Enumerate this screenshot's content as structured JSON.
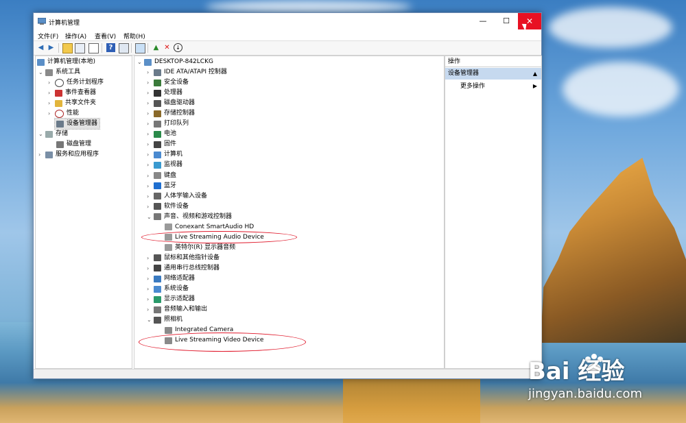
{
  "window": {
    "title": "计算机管理",
    "min_label": "—",
    "max_label": "☐",
    "close_label": "✕"
  },
  "menu": [
    "文件(F)",
    "操作(A)",
    "查看(V)",
    "帮助(H)"
  ],
  "left_tree": {
    "root": "计算机管理(本地)",
    "system_tools": "系统工具",
    "task_scheduler": "任务计划程序",
    "event_viewer": "事件查看器",
    "shared_folders": "共享文件夹",
    "performance": "性能",
    "device_manager": "设备管理器",
    "storage": "存储",
    "disk_management": "磁盘管理",
    "services_apps": "服务和应用程序"
  },
  "device_tree": {
    "computer_name": "DESKTOP-842LCKG",
    "categories": [
      "IDE ATA/ATAPI 控制器",
      "安全设备",
      "处理器",
      "磁盘驱动器",
      "存储控制器",
      "打印队列",
      "电池",
      "固件",
      "计算机",
      "监视器",
      "键盘",
      "蓝牙",
      "人体学输入设备",
      "软件设备",
      "声音、视频和游戏控制器"
    ],
    "audio_children": [
      "Conexant SmartAudio HD",
      "Live Streaming Audio Device",
      "英特尔(R) 显示器音频"
    ],
    "categories_after": [
      "鼠标和其他指针设备",
      "通用串行总线控制器",
      "网络适配器",
      "系统设备",
      "显示适配器",
      "音频输入和输出",
      "照相机"
    ],
    "camera_children": [
      "Integrated Camera",
      "Live Streaming Video Device"
    ]
  },
  "actions": {
    "header": "操作",
    "section": "设备管理器",
    "more": "更多操作"
  },
  "watermark": {
    "brand": "Bai  经验",
    "url": "jingyan.baidu.com"
  },
  "colors": {
    "close_button": "#e81123",
    "highlight_ellipse": "#e0182a",
    "actions_section": "#c6d9ef"
  }
}
